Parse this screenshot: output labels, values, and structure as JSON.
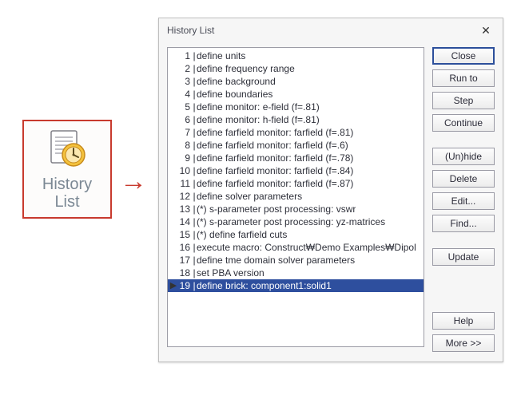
{
  "ribbon": {
    "label_line1": "History",
    "label_line2": "List",
    "icon_name": "history-list-icon"
  },
  "dialog": {
    "title": "History List",
    "close_label": "✕"
  },
  "history": {
    "items": [
      {
        "n": "1",
        "text": "define units",
        "marker": ""
      },
      {
        "n": "2",
        "text": "define frequency range",
        "marker": ""
      },
      {
        "n": "3",
        "text": "define background",
        "marker": ""
      },
      {
        "n": "4",
        "text": "define boundaries",
        "marker": ""
      },
      {
        "n": "5",
        "text": "define monitor: e-field (f=.81)",
        "marker": ""
      },
      {
        "n": "6",
        "text": "define monitor: h-field (f=.81)",
        "marker": ""
      },
      {
        "n": "7",
        "text": "define farfield monitor: farfield (f=.81)",
        "marker": ""
      },
      {
        "n": "8",
        "text": "define farfield monitor: farfield (f=.6)",
        "marker": ""
      },
      {
        "n": "9",
        "text": "define farfield monitor: farfield (f=.78)",
        "marker": ""
      },
      {
        "n": "10",
        "text": "define farfield monitor: farfield (f=.84)",
        "marker": ""
      },
      {
        "n": "11",
        "text": "define farfield monitor: farfield (f=.87)",
        "marker": ""
      },
      {
        "n": "12",
        "text": "define solver parameters",
        "marker": ""
      },
      {
        "n": "13",
        "text": "(*) s-parameter post processing: vswr",
        "marker": ""
      },
      {
        "n": "14",
        "text": "(*) s-parameter post processing: yz-matrices",
        "marker": ""
      },
      {
        "n": "15",
        "text": "(*) define farfield cuts",
        "marker": ""
      },
      {
        "n": "16",
        "text": "execute macro: Construct₩Demo Examples₩Dipol",
        "marker": ""
      },
      {
        "n": "17",
        "text": "define tme domain solver parameters",
        "marker": ""
      },
      {
        "n": "18",
        "text": "set PBA version",
        "marker": ""
      },
      {
        "n": "19",
        "text": "define brick: component1:solid1",
        "marker": "▶",
        "selected": true
      }
    ]
  },
  "buttons": {
    "close": "Close",
    "runto": "Run to",
    "step": "Step",
    "continue": "Continue",
    "unhide": "(Un)hide",
    "delete": "Delete",
    "edit": "Edit...",
    "find": "Find...",
    "update": "Update",
    "help": "Help",
    "more": "More >>"
  },
  "arrow": "→"
}
